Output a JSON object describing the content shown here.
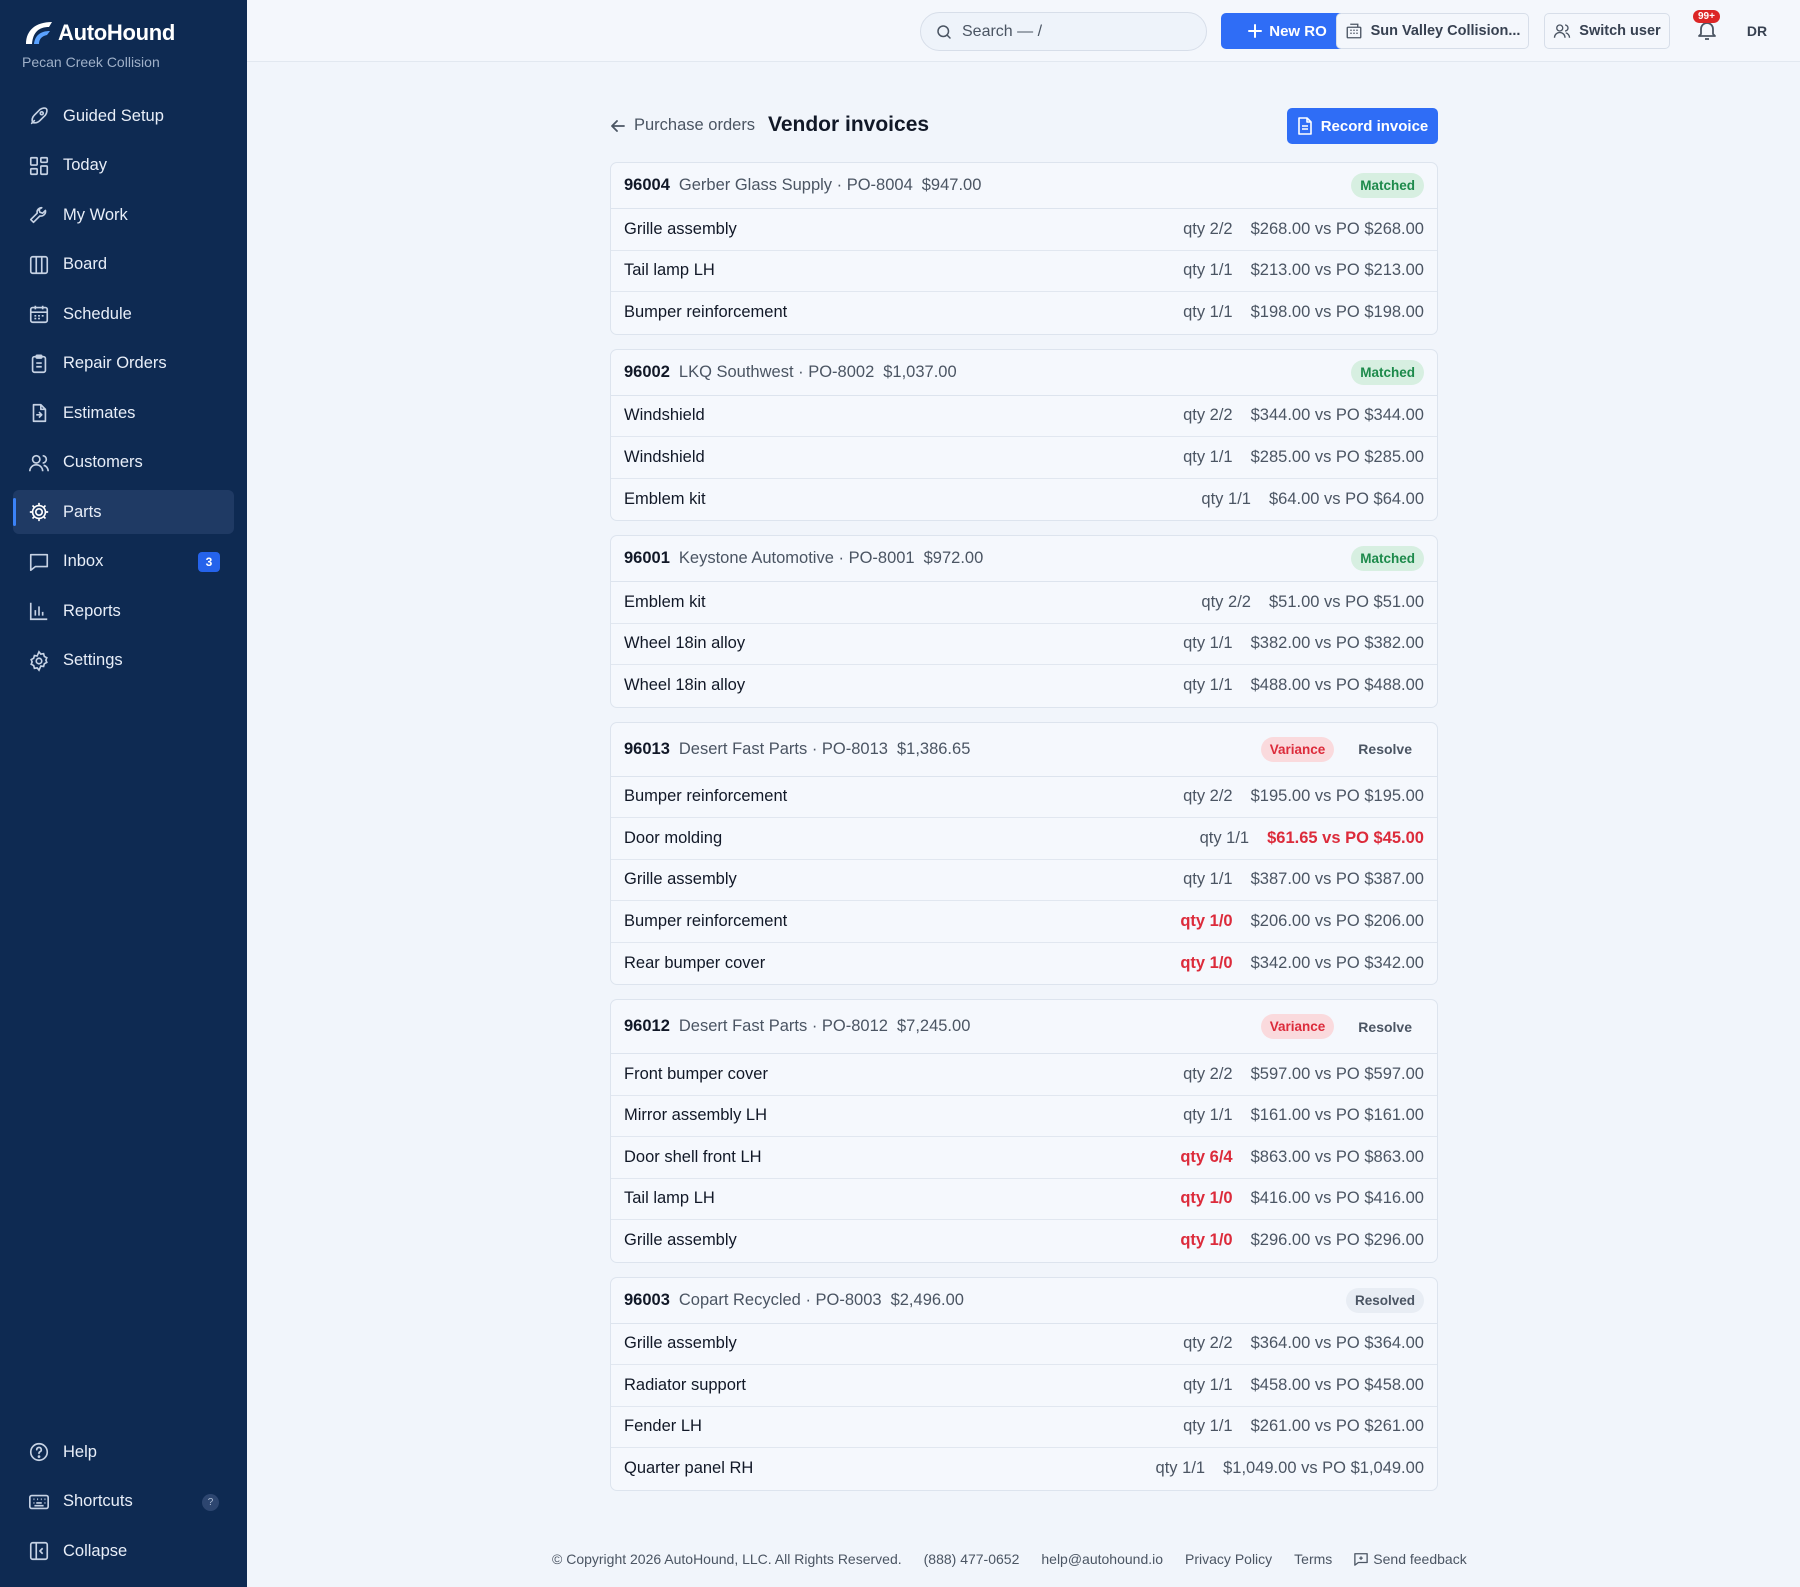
{
  "brand": {
    "name": "AutoHound",
    "shop": "Pecan Creek Collision"
  },
  "nav": [
    {
      "label": "Guided Setup",
      "icon": "rocket-icon"
    },
    {
      "label": "Today",
      "icon": "dashboard-icon"
    },
    {
      "label": "My Work",
      "icon": "wrench-icon"
    },
    {
      "label": "Board",
      "icon": "board-icon"
    },
    {
      "label": "Schedule",
      "icon": "calendar-icon"
    },
    {
      "label": "Repair Orders",
      "icon": "clipboard-icon"
    },
    {
      "label": "Estimates",
      "icon": "estimate-icon"
    },
    {
      "label": "Customers",
      "icon": "users-icon"
    },
    {
      "label": "Parts",
      "icon": "gear-icon",
      "active": true
    },
    {
      "label": "Inbox",
      "icon": "message-icon",
      "badge": "3"
    },
    {
      "label": "Reports",
      "icon": "bar-chart-icon"
    },
    {
      "label": "Settings",
      "icon": "settings-icon"
    }
  ],
  "nav_bottom": {
    "help": "Help",
    "shortcuts": "Shortcuts",
    "shortcuts_key": "?",
    "collapse": "Collapse"
  },
  "topbar": {
    "search_placeholder": "Search — /",
    "new_ro": "New RO",
    "location": "Sun Valley Collision...",
    "switch_user": "Switch user",
    "notif_count": "99+",
    "avatar": "DR"
  },
  "page": {
    "back": "Purchase orders",
    "title": "Vendor invoices",
    "record": "Record invoice"
  },
  "invoices": [
    {
      "num": "96004",
      "meta": "Gerber Glass Supply · PO-8004",
      "total": "$947.00",
      "status": "Matched",
      "lines": [
        {
          "name": "Grille assembly",
          "qty": "qty 2/2",
          "price": "$268.00 vs PO $268.00"
        },
        {
          "name": "Tail lamp LH",
          "qty": "qty 1/1",
          "price": "$213.00 vs PO $213.00"
        },
        {
          "name": "Bumper reinforcement",
          "qty": "qty 1/1",
          "price": "$198.00 vs PO $198.00"
        }
      ]
    },
    {
      "num": "96002",
      "meta": "LKQ Southwest · PO-8002",
      "total": "$1,037.00",
      "status": "Matched",
      "lines": [
        {
          "name": "Windshield",
          "qty": "qty 2/2",
          "price": "$344.00 vs PO $344.00"
        },
        {
          "name": "Windshield",
          "qty": "qty 1/1",
          "price": "$285.00 vs PO $285.00"
        },
        {
          "name": "Emblem kit",
          "qty": "qty 1/1",
          "price": "$64.00 vs PO $64.00"
        }
      ]
    },
    {
      "num": "96001",
      "meta": "Keystone Automotive · PO-8001",
      "total": "$972.00",
      "status": "Matched",
      "lines": [
        {
          "name": "Emblem kit",
          "qty": "qty 2/2",
          "price": "$51.00 vs PO $51.00"
        },
        {
          "name": "Wheel 18in alloy",
          "qty": "qty 1/1",
          "price": "$382.00 vs PO $382.00"
        },
        {
          "name": "Wheel 18in alloy",
          "qty": "qty 1/1",
          "price": "$488.00 vs PO $488.00"
        }
      ]
    },
    {
      "num": "96013",
      "meta": "Desert Fast Parts · PO-8013",
      "total": "$1,386.65",
      "status": "Variance",
      "action": "Resolve",
      "lines": [
        {
          "name": "Bumper reinforcement",
          "qty": "qty 2/2",
          "price": "$195.00 vs PO $195.00"
        },
        {
          "name": "Door molding",
          "qty": "qty 1/1",
          "price": "$61.65 vs PO $45.00",
          "price_flag": true
        },
        {
          "name": "Grille assembly",
          "qty": "qty 1/1",
          "price": "$387.00 vs PO $387.00"
        },
        {
          "name": "Bumper reinforcement",
          "qty": "qty 1/0",
          "price": "$206.00 vs PO $206.00",
          "qty_flag": true
        },
        {
          "name": "Rear bumper cover",
          "qty": "qty 1/0",
          "price": "$342.00 vs PO $342.00",
          "qty_flag": true
        }
      ]
    },
    {
      "num": "96012",
      "meta": "Desert Fast Parts · PO-8012",
      "total": "$7,245.00",
      "status": "Variance",
      "action": "Resolve",
      "lines": [
        {
          "name": "Front bumper cover",
          "qty": "qty 2/2",
          "price": "$597.00 vs PO $597.00"
        },
        {
          "name": "Mirror assembly LH",
          "qty": "qty 1/1",
          "price": "$161.00 vs PO $161.00"
        },
        {
          "name": "Door shell front LH",
          "qty": "qty 6/4",
          "price": "$863.00 vs PO $863.00",
          "qty_flag": true
        },
        {
          "name": "Tail lamp LH",
          "qty": "qty 1/0",
          "price": "$416.00 vs PO $416.00",
          "qty_flag": true
        },
        {
          "name": "Grille assembly",
          "qty": "qty 1/0",
          "price": "$296.00 vs PO $296.00",
          "qty_flag": true
        }
      ]
    },
    {
      "num": "96003",
      "meta": "Copart Recycled · PO-8003",
      "total": "$2,496.00",
      "status": "Resolved",
      "lines": [
        {
          "name": "Grille assembly",
          "qty": "qty 2/2",
          "price": "$364.00 vs PO $364.00"
        },
        {
          "name": "Radiator support",
          "qty": "qty 1/1",
          "price": "$458.00 vs PO $458.00"
        },
        {
          "name": "Fender LH",
          "qty": "qty 1/1",
          "price": "$261.00 vs PO $261.00"
        },
        {
          "name": "Quarter panel RH",
          "qty": "qty 1/1",
          "price": "$1,049.00 vs PO $1,049.00"
        }
      ]
    }
  ],
  "footer": {
    "copyright": "© Copyright 2026 AutoHound, LLC. All Rights Reserved.",
    "phone": "(888) 477-0652",
    "email": "help@autohound.io",
    "privacy": "Privacy Policy",
    "terms": "Terms",
    "feedback": "Send feedback"
  }
}
